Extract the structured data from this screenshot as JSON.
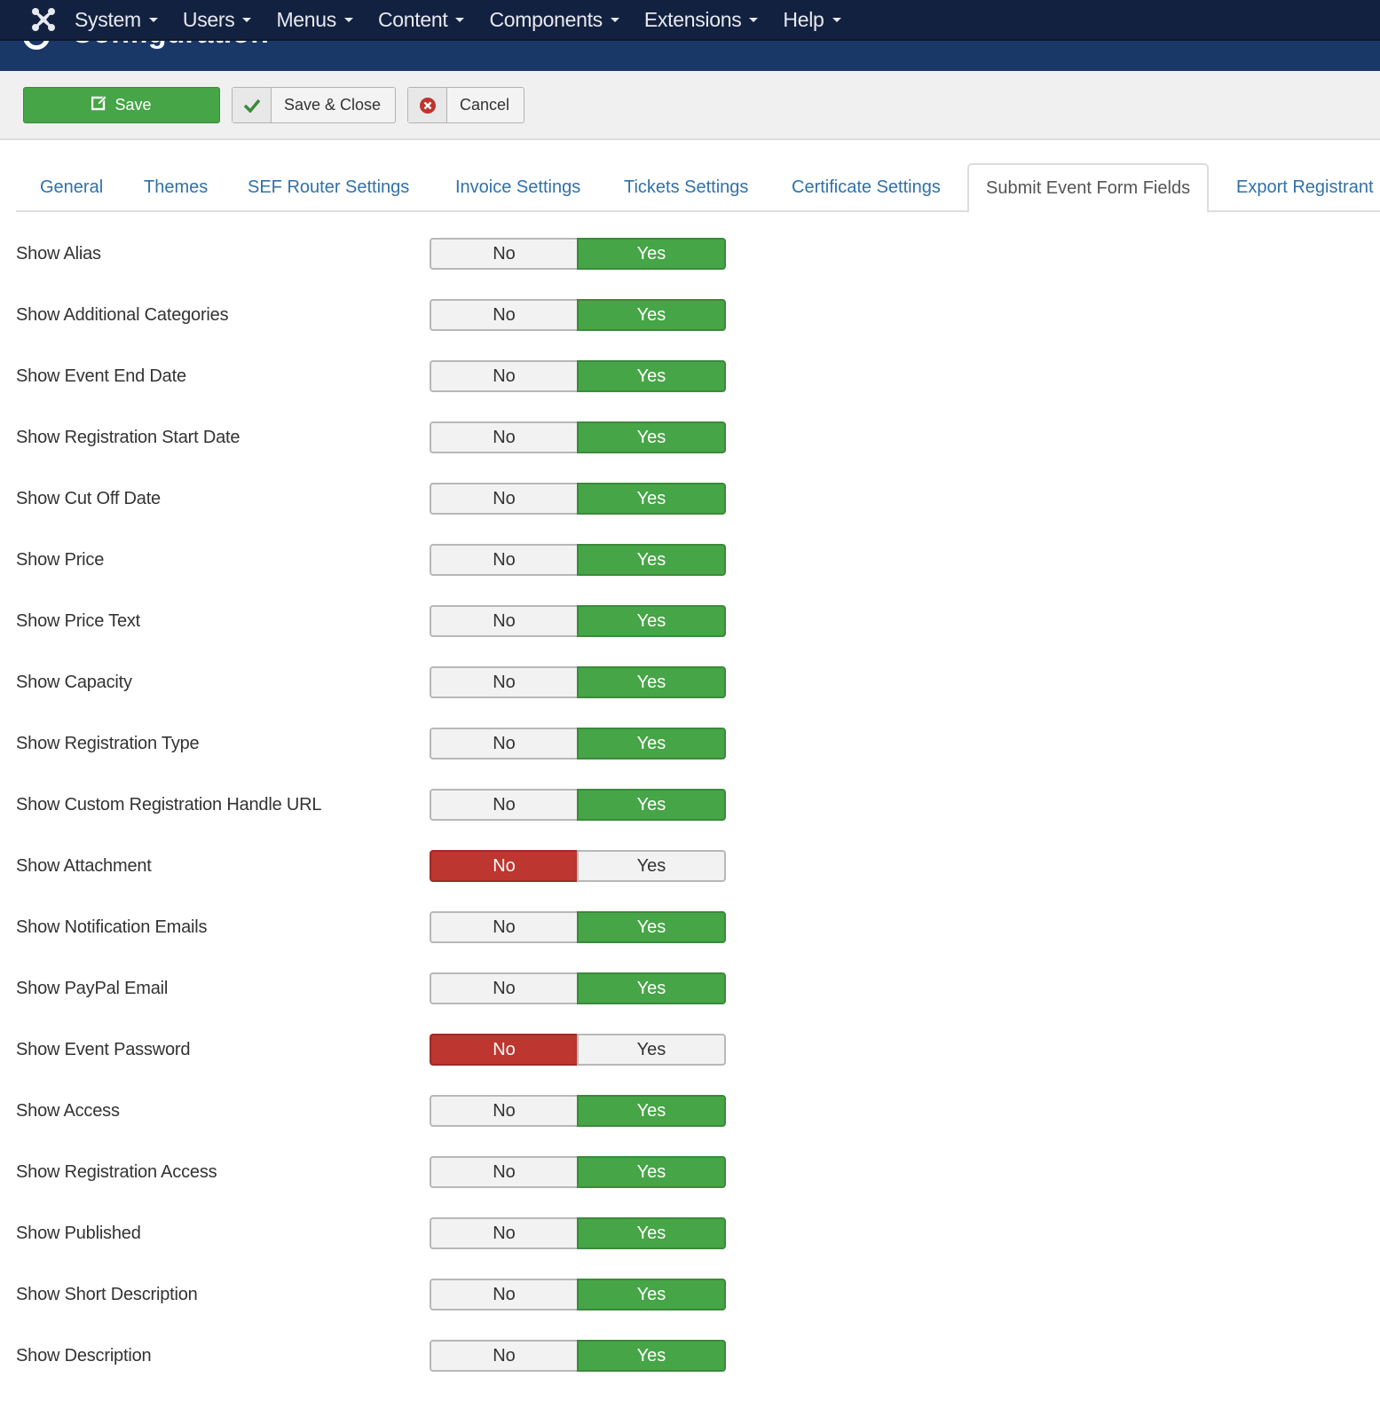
{
  "header": {
    "title": "Configuration",
    "nav": [
      {
        "label": "System"
      },
      {
        "label": "Users"
      },
      {
        "label": "Menus"
      },
      {
        "label": "Content"
      },
      {
        "label": "Components"
      },
      {
        "label": "Extensions"
      },
      {
        "label": "Help"
      }
    ]
  },
  "toolbar": {
    "save_label": "Save",
    "save_close_label": "Save & Close",
    "cancel_label": "Cancel"
  },
  "tabs": [
    {
      "label": "General",
      "active": false
    },
    {
      "label": "Themes",
      "active": false
    },
    {
      "label": "SEF Router Settings",
      "active": false
    },
    {
      "label": "Invoice Settings",
      "active": false
    },
    {
      "label": "Tickets Settings",
      "active": false
    },
    {
      "label": "Certificate Settings",
      "active": false
    },
    {
      "label": "Submit Event Form Fields",
      "active": true
    },
    {
      "label": "Export Registrant",
      "active": false
    }
  ],
  "toggle_labels": {
    "no": "No",
    "yes": "Yes"
  },
  "settings": [
    {
      "label": "Show Alias",
      "value": "Yes"
    },
    {
      "label": "Show Additional Categories",
      "value": "Yes"
    },
    {
      "label": "Show Event End Date",
      "value": "Yes"
    },
    {
      "label": "Show Registration Start Date",
      "value": "Yes"
    },
    {
      "label": "Show Cut Off Date",
      "value": "Yes"
    },
    {
      "label": "Show Price",
      "value": "Yes"
    },
    {
      "label": "Show Price Text",
      "value": "Yes"
    },
    {
      "label": "Show Capacity",
      "value": "Yes"
    },
    {
      "label": "Show Registration Type",
      "value": "Yes"
    },
    {
      "label": "Show Custom Registration Handle URL",
      "value": "Yes"
    },
    {
      "label": "Show Attachment",
      "value": "No"
    },
    {
      "label": "Show Notification Emails",
      "value": "Yes"
    },
    {
      "label": "Show PayPal Email",
      "value": "Yes"
    },
    {
      "label": "Show Event Password",
      "value": "No"
    },
    {
      "label": "Show Access",
      "value": "Yes"
    },
    {
      "label": "Show Registration Access",
      "value": "Yes"
    },
    {
      "label": "Show Published",
      "value": "Yes"
    },
    {
      "label": "Show Short Description",
      "value": "Yes"
    },
    {
      "label": "Show Description",
      "value": "Yes"
    }
  ],
  "colors": {
    "navbar": "#132140",
    "subhead": "#1a3867",
    "success": "#46a546",
    "danger": "#bd362f",
    "link": "#3071a9"
  }
}
